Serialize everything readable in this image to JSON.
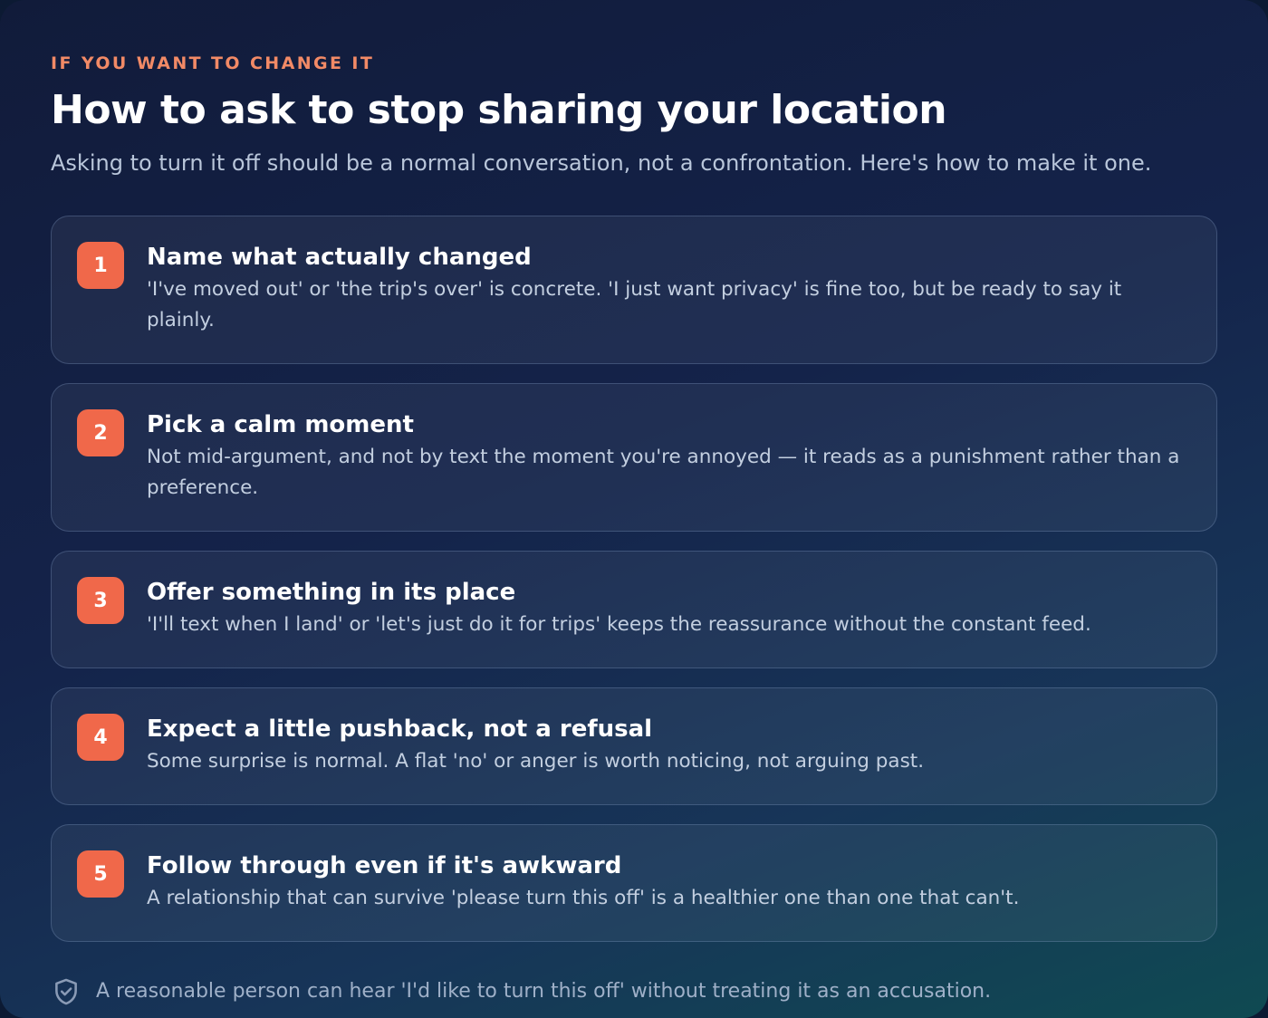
{
  "header": {
    "eyebrow": "IF YOU WANT TO CHANGE IT",
    "title": "How to ask to stop sharing your location",
    "subtitle": "Asking to turn it off should be a normal conversation, not a confrontation. Here's how to make it one."
  },
  "steps": [
    {
      "number": "1",
      "title": "Name what actually changed",
      "description": "'I've moved out' or 'the trip's over' is concrete. 'I just want privacy' is fine too, but be ready to say it plainly."
    },
    {
      "number": "2",
      "title": "Pick a calm moment",
      "description": "Not mid-argument, and not by text the moment you're annoyed — it reads as a punishment rather than a preference."
    },
    {
      "number": "3",
      "title": "Offer something in its place",
      "description": "'I'll text when I land' or 'let's just do it for trips' keeps the reassurance without the constant feed."
    },
    {
      "number": "4",
      "title": "Expect a little pushback, not a refusal",
      "description": "Some surprise is normal. A flat 'no' or anger is worth noticing, not arguing past."
    },
    {
      "number": "5",
      "title": "Follow through even if it's awkward",
      "description": "A relationship that can survive 'please turn this off' is a healthier one than one that can't."
    }
  ],
  "footer": {
    "icon": "shield-check-icon",
    "text": "A reasonable person can hear 'I'd like to turn this off' without treating it as an accusation."
  },
  "colors": {
    "accent": "#f0684a",
    "eyebrow": "#f28a66",
    "background_start": "#111b3a",
    "background_end": "#0f4a52"
  }
}
